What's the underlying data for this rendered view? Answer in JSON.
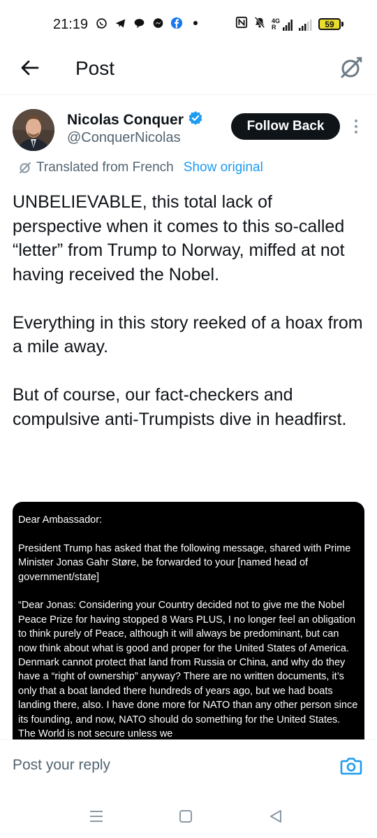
{
  "status_bar": {
    "time": "21:19",
    "network_label": "4G",
    "network_sub": "R",
    "battery": "59",
    "notification_icons": [
      "whatsapp-icon",
      "telegram-icon",
      "chat-bubble-icon",
      "messenger-icon",
      "facebook-icon",
      "dot-icon"
    ],
    "system_icons": [
      "nfc-icon",
      "mute-icon",
      "signal-icon",
      "battery-icon"
    ]
  },
  "header": {
    "title": "Post",
    "back_icon": "back-arrow-icon",
    "grok_icon": "grok-icon"
  },
  "author": {
    "name": "Nicolas Conquer",
    "handle": "@ConquerNicolas",
    "verified": true,
    "follow_label": "Follow Back"
  },
  "translation": {
    "text": "Translated from French",
    "show_original": "Show original"
  },
  "post": {
    "paragraphs": [
      "UNBELIEVABLE, this total lack of perspective when it comes to this so-called “letter” from Trump to Norway, miffed at not having received the Nobel.",
      "Everything in this story reeked of a hoax from a mile away.",
      "But of course, our fact-checkers and compulsive anti-Trumpists dive in headfirst."
    ]
  },
  "media": {
    "paragraphs": [
      "Dear Ambassador:",
      "President Trump has asked that the following message, shared with Prime Minister Jonas Gahr Støre, be forwarded to your [named head of government/state]",
      "“Dear Jonas: Considering your Country decided not to give me the Nobel Peace Prize for having stopped 8 Wars PLUS, I no longer feel an obligation to think purely of Peace, although it will always be predominant, but can now think about what is good and proper for the United States of America. Denmark cannot protect that land from Russia or China, and why do they have a “right of ownership” anyway? There are no written documents, it’s only that a boat landed there hundreds of years ago, but we had boats landing there, also. I have done more for NATO than any other person since its founding, and now, NATO should do something for the United States. The World is not secure unless we"
    ]
  },
  "reply": {
    "placeholder": "Post your reply"
  },
  "colors": {
    "accent": "#1d9bf0",
    "text_primary": "#0f1419",
    "text_secondary": "#536471",
    "battery_fill": "#e9dc2c"
  }
}
